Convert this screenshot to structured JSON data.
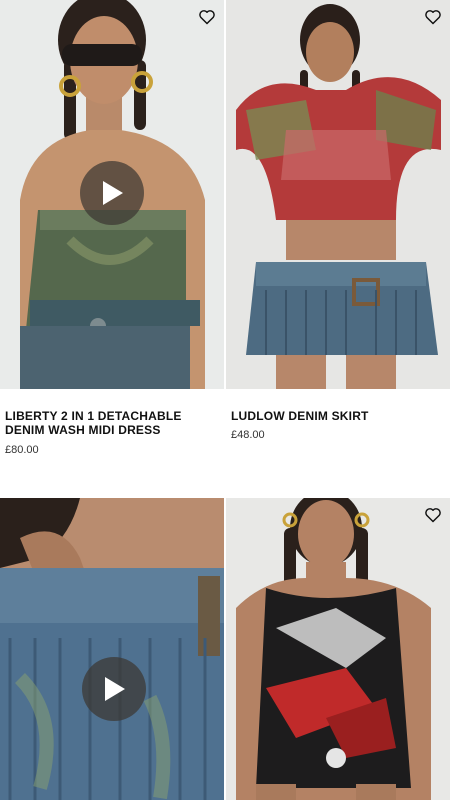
{
  "products": [
    {
      "name": "LIBERTY 2 IN 1 DETACHABLE DENIM WASH MIDI DRESS",
      "price": "£80.00",
      "media": "video",
      "wishlist_icon": "heart-outline-icon",
      "play_icon": "play-icon"
    },
    {
      "name": "LUDLOW DENIM SKIRT",
      "price": "£48.00",
      "media": "image",
      "wishlist_icon": "heart-outline-icon"
    },
    {
      "name": "",
      "price": "",
      "media": "video",
      "play_icon": "play-icon"
    },
    {
      "name": "",
      "price": "",
      "media": "image",
      "wishlist_icon": "heart-outline-icon"
    }
  ],
  "colors": {
    "text": "#111111",
    "price": "#333333",
    "play_bg": "#3c3732"
  }
}
